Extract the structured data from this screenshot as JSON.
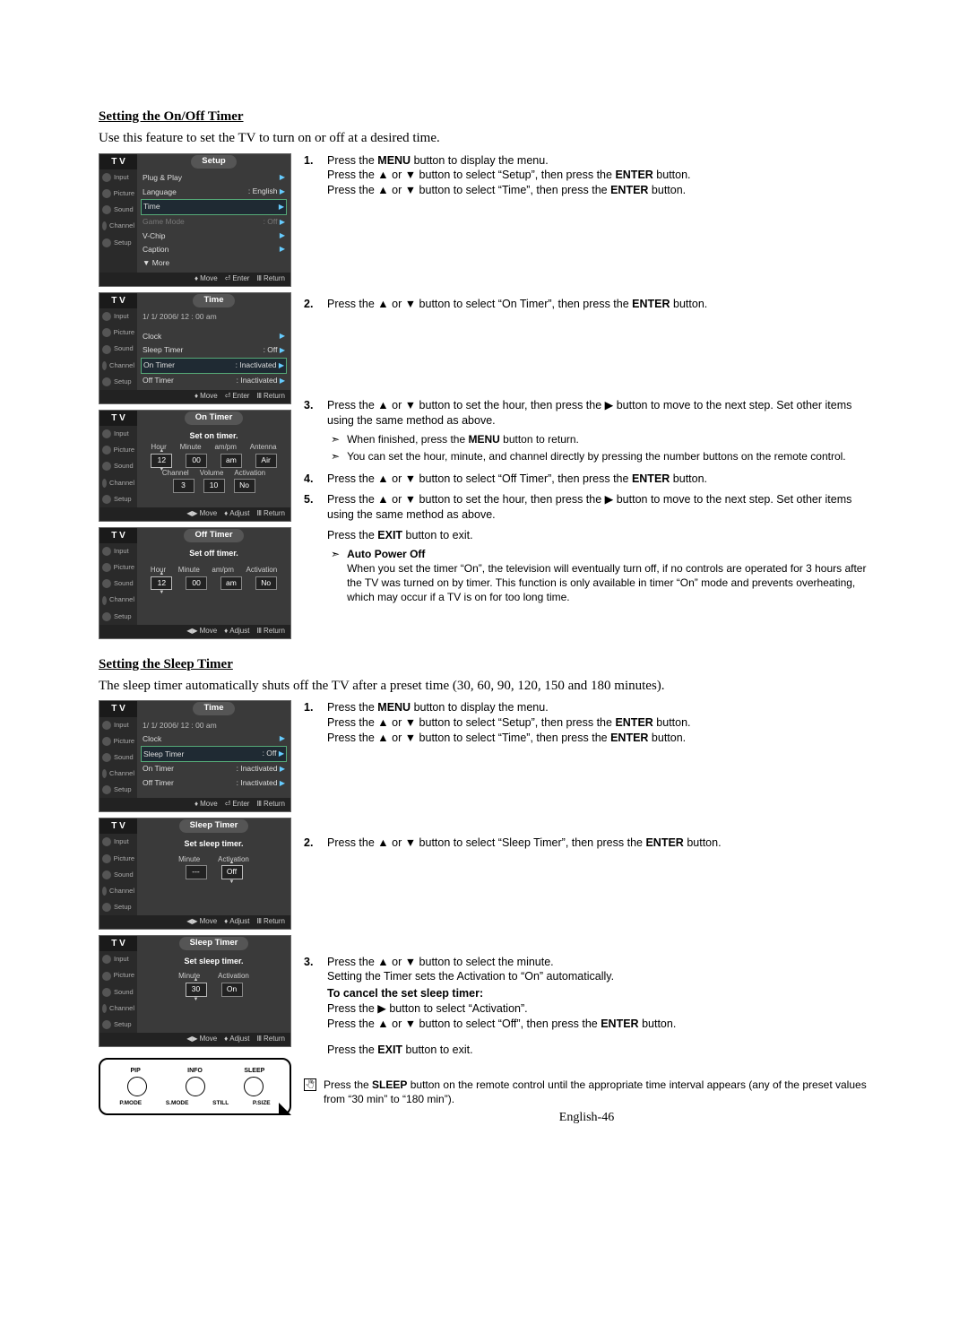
{
  "section1": {
    "title": "Setting the On/Off Timer",
    "lead": "Use this feature to set the TV to turn on or off at a desired time."
  },
  "osd_sidebar": {
    "tv": "T V",
    "input": "Input",
    "picture": "Picture",
    "sound": "Sound",
    "channel": "Channel",
    "setup": "Setup"
  },
  "osd_hint": {
    "move_ud": "Move",
    "move_lr": "Move",
    "enter": "Enter",
    "return": "Return",
    "adjust": "Adjust"
  },
  "osd1": {
    "title": "Setup",
    "rows": [
      {
        "l": "Plug & Play",
        "r": "",
        "mode": "norm"
      },
      {
        "l": "Language",
        "r": ": English",
        "mode": "norm"
      },
      {
        "l": "Time",
        "r": "",
        "mode": "sel"
      },
      {
        "l": "Game Mode",
        "r": ": Off",
        "mode": "disabled"
      },
      {
        "l": "V-Chip",
        "r": "",
        "mode": "norm"
      },
      {
        "l": "Caption",
        "r": "",
        "mode": "norm"
      },
      {
        "l": "▼ More",
        "r": "",
        "mode": "norm"
      }
    ]
  },
  "osd2": {
    "title": "Time",
    "datetime": "1/ 1/ 2006/  12 : 00  am",
    "rows": [
      {
        "l": "Clock",
        "r": "",
        "mode": "norm"
      },
      {
        "l": "Sleep Timer",
        "r": ": Off",
        "mode": "norm"
      },
      {
        "l": "On Timer",
        "r": ": Inactivated",
        "mode": "sel"
      },
      {
        "l": "Off Timer",
        "r": ": Inactivated",
        "mode": "norm"
      }
    ]
  },
  "osd3": {
    "title": "On Timer",
    "subtitle": "Set on timer.",
    "top_labels": [
      "Hour",
      "Minute",
      "am/pm",
      "Antenna"
    ],
    "top_vals": [
      "12",
      "00",
      "am",
      "Air"
    ],
    "bot_labels": [
      "Channel",
      "Volume",
      "Activation"
    ],
    "bot_vals": [
      "3",
      "10",
      "No"
    ]
  },
  "osd4": {
    "title": "Off Timer",
    "subtitle": "Set off timer.",
    "labels": [
      "Hour",
      "Minute",
      "am/pm",
      "Activation"
    ],
    "vals": [
      "12",
      "00",
      "am",
      "No"
    ]
  },
  "steps1": {
    "s1": {
      "l1": "Press the ",
      "b1": "MENU",
      "l2": " button to display the menu.",
      "l3": "Press the ▲ or ▼ button to select “Setup”, then press the ",
      "b2": "ENTER",
      "l4": " button.",
      "l5": "Press the ▲ or ▼ button to select “Time”, then press the ",
      "b3": "ENTER",
      "l6": " button."
    },
    "s2": {
      "l1": "Press the ▲ or ▼ button to select “On Timer”, then press the ",
      "b1": "ENTER",
      "l2": " button."
    },
    "s3": {
      "l1": "Press the ▲ or ▼ button to set the hour, then press the ▶ button to move to the next step. Set other items using the same method as above.",
      "sub1a": "When finished, press the ",
      "sub1b": "MENU",
      "sub1c": " button to return.",
      "sub2": "You can set the hour, minute, and channel directly by pressing the number buttons on the remote control."
    },
    "s4": {
      "l1": "Press the ▲ or ▼ button to select “Off Timer”, then press the ",
      "b1": "ENTER",
      "l2": " button."
    },
    "s5": {
      "l1": "Press the ▲ or ▼ button to set the hour, then press the ▶ button to move to the next step. Set other items using the same method as above.",
      "exit1": "Press the ",
      "exitb": "EXIT",
      "exit2": " button to exit.",
      "apo_title": "Auto Power Off",
      "apo_body": "When you set the timer “On”, the television will eventually turn off, if no controls are operated for 3 hours after the TV was turned on by timer. This function is only available in timer “On” mode and prevents overheating, which may occur if a TV is on for too long time."
    }
  },
  "section2": {
    "title": "Setting the Sleep Timer",
    "lead": "The sleep timer automatically shuts off the TV after a preset time (30, 60, 90, 120, 150 and 180 minutes)."
  },
  "osd5": {
    "title": "Time",
    "datetime": "1/ 1/ 2006/  12 : 00  am",
    "rows": [
      {
        "l": "Clock",
        "r": "",
        "mode": "norm"
      },
      {
        "l": "Sleep Timer",
        "r": ": Off",
        "mode": "sel"
      },
      {
        "l": "On Timer",
        "r": ": Inactivated",
        "mode": "norm"
      },
      {
        "l": "Off Timer",
        "r": ": Inactivated",
        "mode": "norm"
      }
    ]
  },
  "osd6": {
    "title": "Sleep Timer",
    "subtitle": "Set sleep timer.",
    "labels": [
      "Minute",
      "Activation"
    ],
    "vals": [
      "---",
      "Off"
    ]
  },
  "osd7": {
    "title": "Sleep Timer",
    "subtitle": "Set sleep timer.",
    "labels": [
      "Minute",
      "Activation"
    ],
    "vals": [
      "30",
      "On"
    ]
  },
  "steps2": {
    "s1": {
      "l1": "Press the ",
      "b1": "MENU",
      "l2": " button to display the menu.",
      "l3": "Press the ▲ or ▼ button to select “Setup”, then press the ",
      "b2": "ENTER",
      "l4": " button.",
      "l5": "Press the ▲ or ▼ button to select “Time”, then press the ",
      "b3": "ENTER",
      "l6": " button."
    },
    "s2": {
      "l1": "Press the ▲ or ▼ button to select “Sleep Timer”, then press the ",
      "b1": "ENTER",
      "l2": " button."
    },
    "s3": {
      "l1": "Press the ▲ or ▼ button to select the minute.",
      "l2": "Setting the Timer sets the Activation to “On” automatically.",
      "cancel_title": "To cancel the set sleep timer:",
      "c1": "Press the ▶ button to select “Activation”.",
      "c2a": "Press the ▲ or ▼ button to select “Off”, then press the ",
      "c2b": "ENTER",
      "c2c": " button.",
      "exit1": "Press the ",
      "exitb": "EXIT",
      "exit2": " button to exit."
    },
    "note": {
      "a": "Press the ",
      "b": "SLEEP",
      "c": " button on the remote control until the appropriate time interval appears (any of the preset values from “30 min” to “180 min”)."
    }
  },
  "remote": {
    "top": [
      "PIP",
      "INFO",
      "SLEEP"
    ],
    "bot": [
      "P.MODE",
      "S.MODE",
      "STILL",
      "P.SIZE"
    ]
  },
  "page": "English-46"
}
